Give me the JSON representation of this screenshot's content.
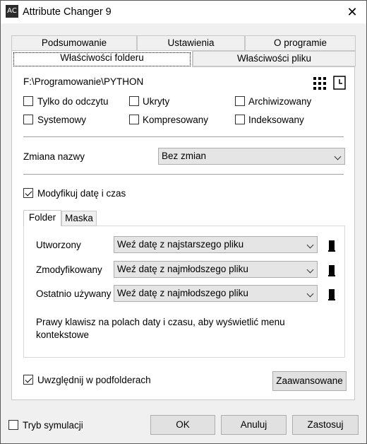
{
  "window": {
    "title": "Attribute Changer 9",
    "app_icon_text": "AC"
  },
  "tabs": {
    "row1": [
      "Podsumowanie",
      "Ustawienia",
      "O programie"
    ],
    "row2": [
      "Właściwości folderu",
      "Właściwości pliku"
    ]
  },
  "folder": {
    "path": "F:\\Programowanie\\PYTHON",
    "attributes": [
      {
        "label": "Tylko do odczytu",
        "checked": false
      },
      {
        "label": "Ukryty",
        "checked": false
      },
      {
        "label": "Archiwizowany",
        "checked": false
      },
      {
        "label": "Systemowy",
        "checked": false
      },
      {
        "label": "Kompresowany",
        "checked": false
      },
      {
        "label": "Indeksowany",
        "checked": false
      }
    ],
    "rename_label": "Zmiana nazwy",
    "rename_value": "Bez zmian",
    "modify_datetime_label": "Modyfikuj datę i czas",
    "modify_datetime_checked": true,
    "inner_tabs": [
      "Folder",
      "Maska"
    ],
    "dates": [
      {
        "label": "Utworzony",
        "value": "Weź datę z najstarszego pliku"
      },
      {
        "label": "Zmodyfikowany",
        "value": "Weź datę z najmłodszego pliku"
      },
      {
        "label": "Ostatnio używany",
        "value": "Weź datę z najmłodszego pliku"
      }
    ],
    "hint": "Prawy klawisz na polach daty i czasu, aby wyświetlić menu kontekstowe",
    "subfolders_label": "Uwzględnij w podfolderach",
    "subfolders_checked": true,
    "advanced_button": "Zaawansowane"
  },
  "footer": {
    "simulation_label": "Tryb symulacji",
    "simulation_checked": false,
    "ok": "OK",
    "cancel": "Anuluj",
    "apply": "Zastosuj"
  },
  "icons": [
    "app-icon",
    "close-icon",
    "grid-icon",
    "clock-icon",
    "chevron-down-icon",
    "date-picker-icon"
  ]
}
